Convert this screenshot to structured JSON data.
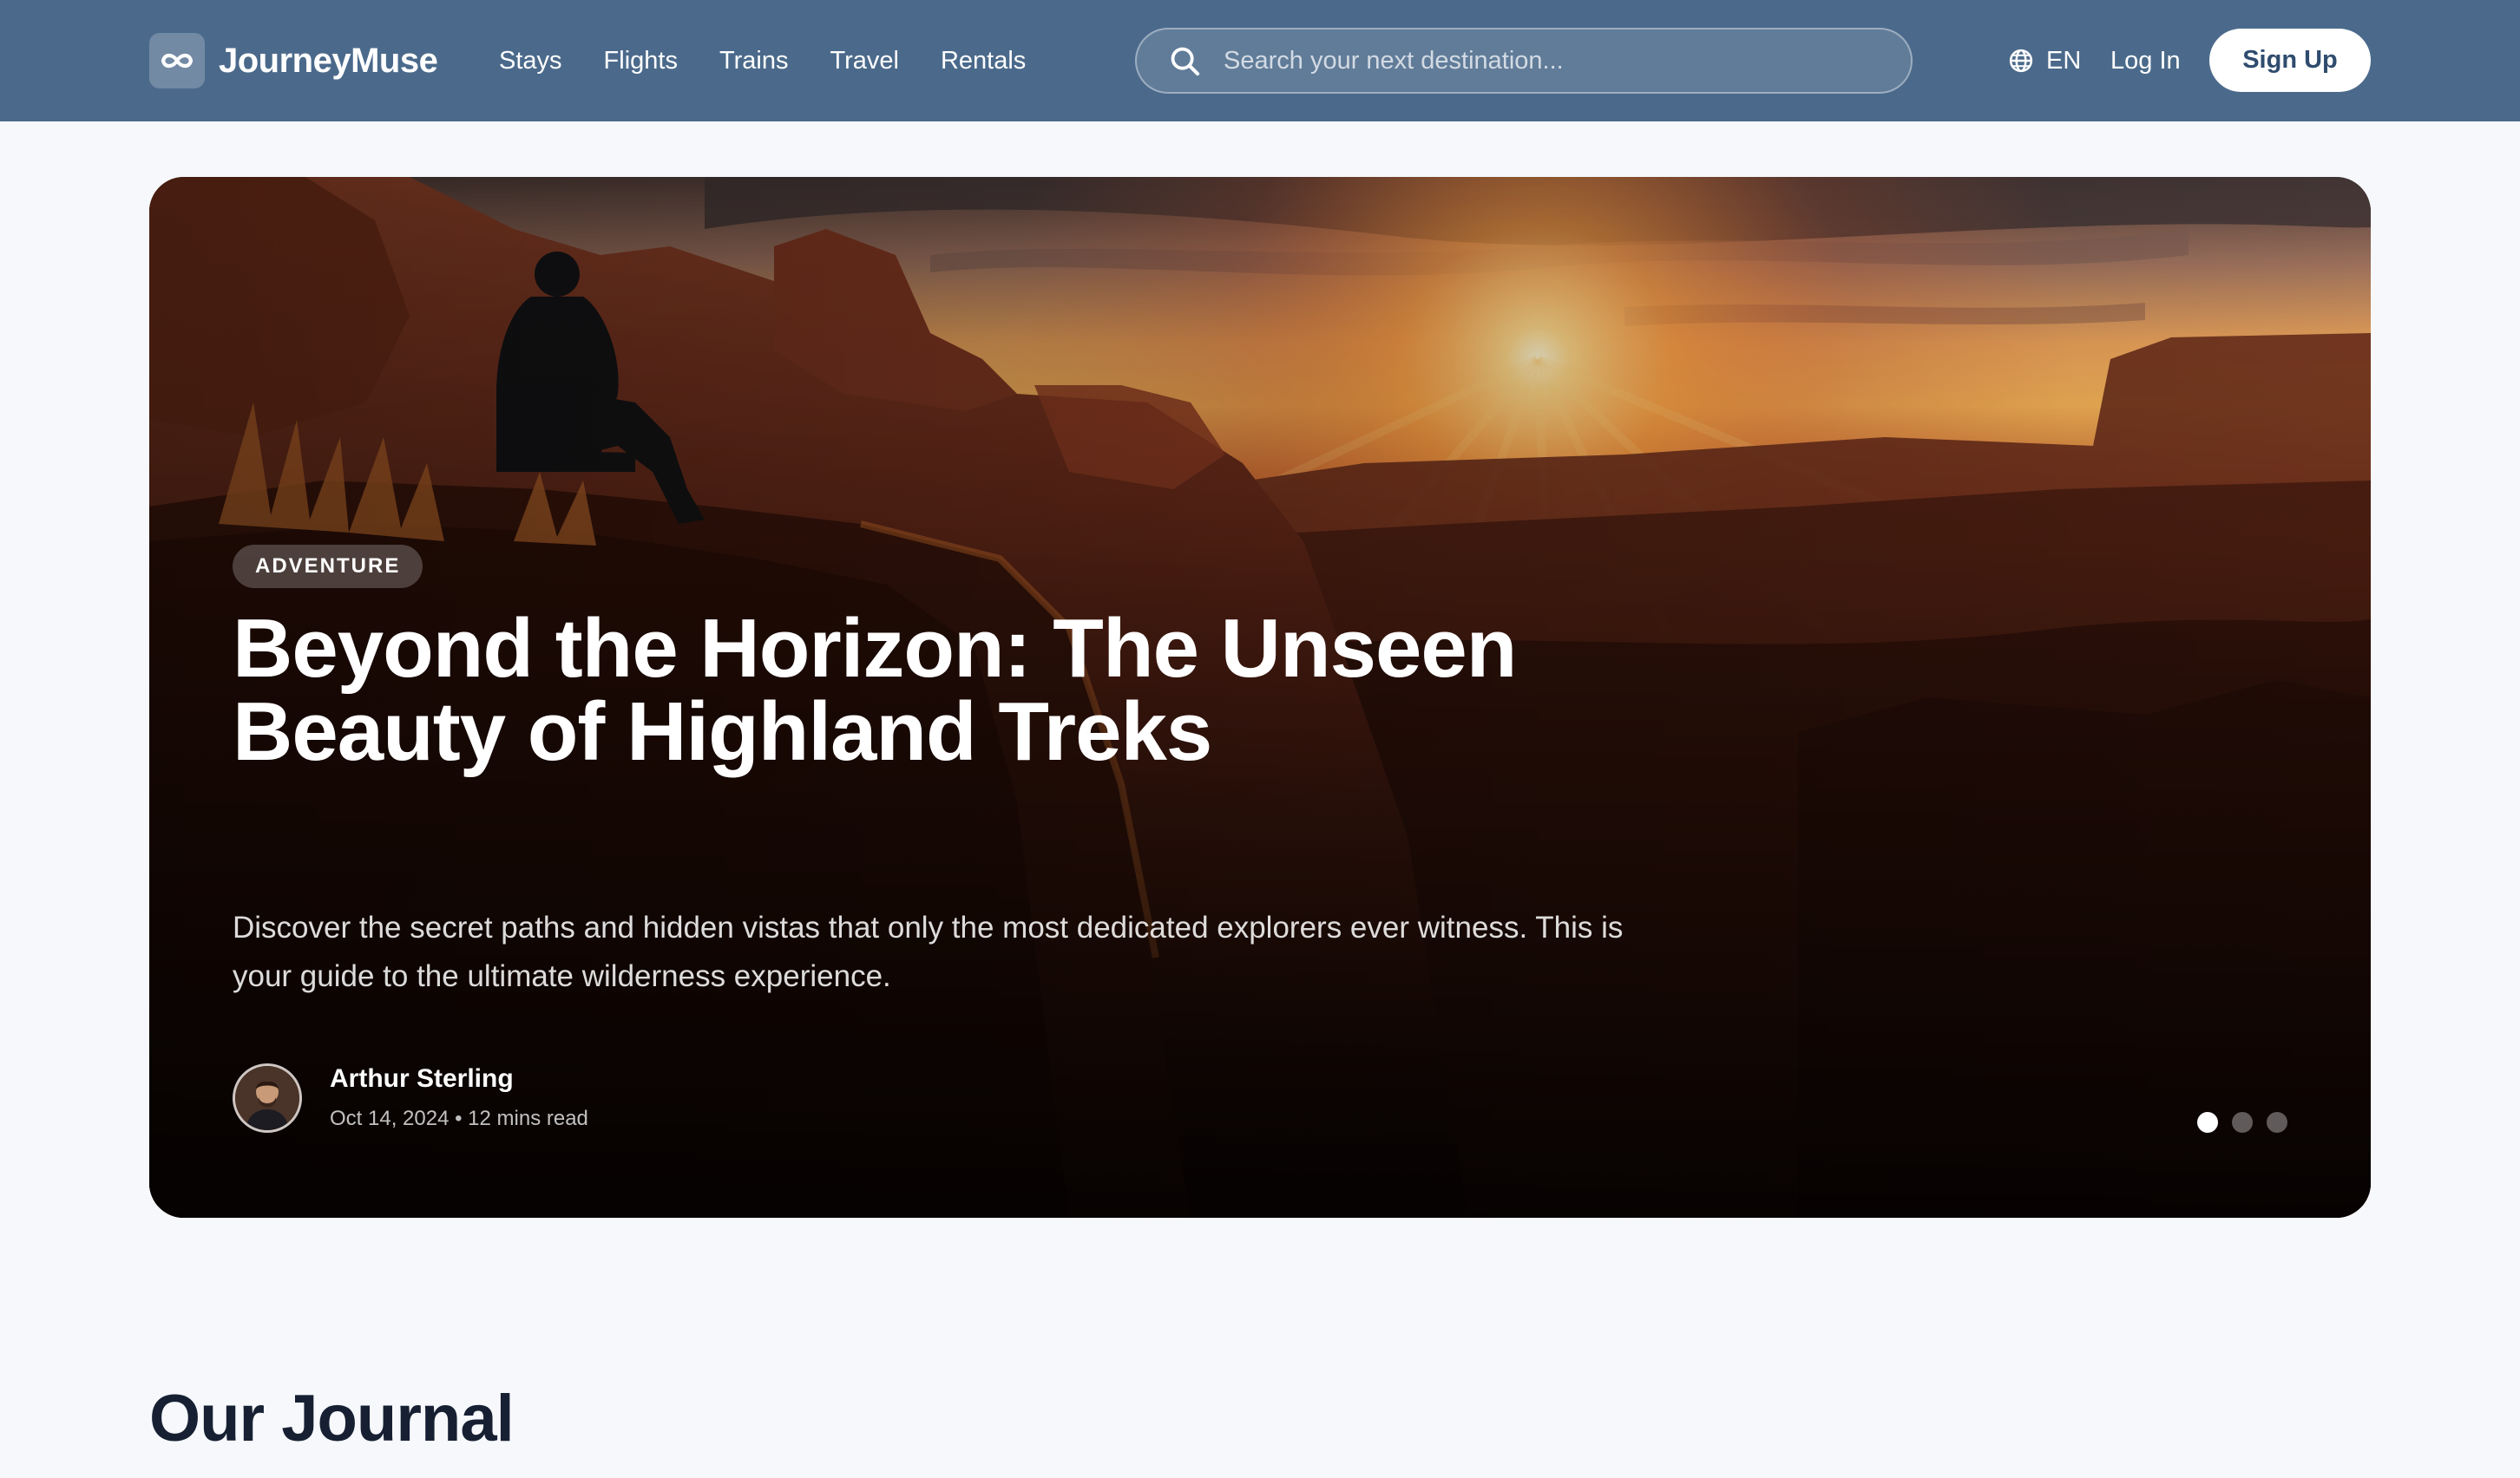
{
  "brand": {
    "name": "JourneyMuse",
    "logo_icon": "infinity-icon"
  },
  "nav": {
    "items": [
      {
        "label": "Stays"
      },
      {
        "label": "Flights"
      },
      {
        "label": "Trains"
      },
      {
        "label": "Travel"
      },
      {
        "label": "Rentals"
      }
    ]
  },
  "search": {
    "placeholder": "Search your next destination...",
    "value": "",
    "icon": "search-icon"
  },
  "language": {
    "code": "EN",
    "icon": "globe-icon"
  },
  "auth": {
    "login_label": "Log In",
    "signup_label": "Sign Up"
  },
  "hero": {
    "badge": "ADVENTURE",
    "title": "Beyond the Horizon: The Unseen Beauty of Highland Treks",
    "description": "Discover the secret paths and hidden vistas that only the most dedicated explorers ever witness. This is your guide to the ultimate wilderness experience.",
    "author": {
      "name": "Arthur Sterling",
      "meta": "Oct 14, 2024 • 12 mins read"
    },
    "carousel": {
      "slide_count": 3,
      "active_slide": 1
    }
  },
  "journal": {
    "title": "Our Journal"
  },
  "colors": {
    "header_bg": "#4b6a8b",
    "page_bg": "#f6f8fb",
    "signup_text": "#2f4c6e",
    "heading_text": "#172033"
  }
}
